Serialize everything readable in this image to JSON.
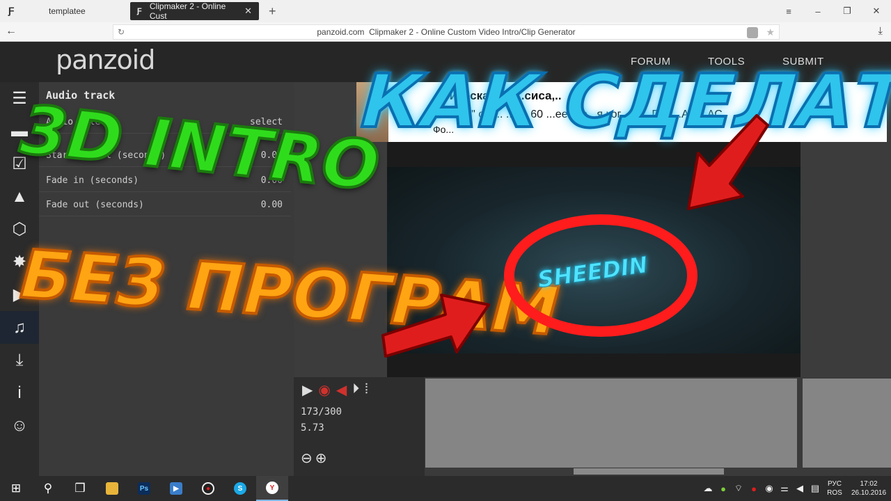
{
  "browser": {
    "tabs": [
      {
        "label": "templatee",
        "active": false
      },
      {
        "label": "Clipmaker 2 - Online Cust",
        "active": true
      }
    ],
    "address": {
      "domain": "panzoid.com",
      "title": "Clipmaker 2 - Online Custom Video Intro/Clip Generator"
    },
    "window_controls": [
      "≡",
      "–",
      "❐",
      "✕"
    ]
  },
  "site": {
    "brand": "panzoid",
    "nav": [
      {
        "label": "FORUM"
      },
      {
        "label": "TOOLS"
      },
      {
        "label": "SUBMIT"
      }
    ]
  },
  "rail": {
    "items": [
      {
        "icon": "menu-icon",
        "glyph": "☰"
      },
      {
        "icon": "folder-icon",
        "glyph": "▬"
      },
      {
        "icon": "checkbox-icon",
        "glyph": "☑"
      },
      {
        "icon": "image-icon",
        "glyph": "▲"
      },
      {
        "icon": "cube-icon",
        "glyph": "⬡"
      },
      {
        "icon": "burst-icon",
        "glyph": "✸"
      },
      {
        "icon": "camera-icon",
        "glyph": "▶"
      },
      {
        "icon": "music-icon",
        "glyph": "♫",
        "active": true
      },
      {
        "icon": "download-icon",
        "glyph": "⤓"
      },
      {
        "icon": "info-icon",
        "glyph": "i"
      },
      {
        "icon": "smiley-icon",
        "glyph": "☺"
      }
    ]
  },
  "panel": {
    "title": "Audio track",
    "rows": [
      {
        "label": "Audio file",
        "value": "select"
      },
      {
        "label": "Start offset (seconds)",
        "value": "0.00"
      },
      {
        "label": "Fade in (seconds)",
        "value": "0.00"
      },
      {
        "label": "Fade out (seconds)",
        "value": "0.00"
      }
    ]
  },
  "embedded_page": {
    "line1": "...сическая ам...сиса,..",
    "line2": "П... с... \" сту... ...по 60 ...ее. Во...я ког...ги... П... ...АТ ...АС",
    "line3": "Фо..."
  },
  "player": {
    "frame": "173/300",
    "seconds": "5.73",
    "controls": [
      "play-icon",
      "eye-icon",
      "mute-icon",
      "step-icon",
      "waveform-icon"
    ]
  },
  "overlay": {
    "title": "КАК СДЕЛАТЬ",
    "intro": "3D INTRO",
    "no_programs": "БЕЗ ПРОГРАМ",
    "video_text": "SHEEDIN"
  },
  "taskbar": {
    "lang": [
      "РУС",
      "ROS"
    ],
    "time": "17:02",
    "date": "26.10.2016"
  },
  "colors": {
    "accent_ring": "#ff1c1c",
    "title_blue": "#2fc4ec",
    "intro_green": "#2fdc1c",
    "orange": "#ffa412"
  }
}
